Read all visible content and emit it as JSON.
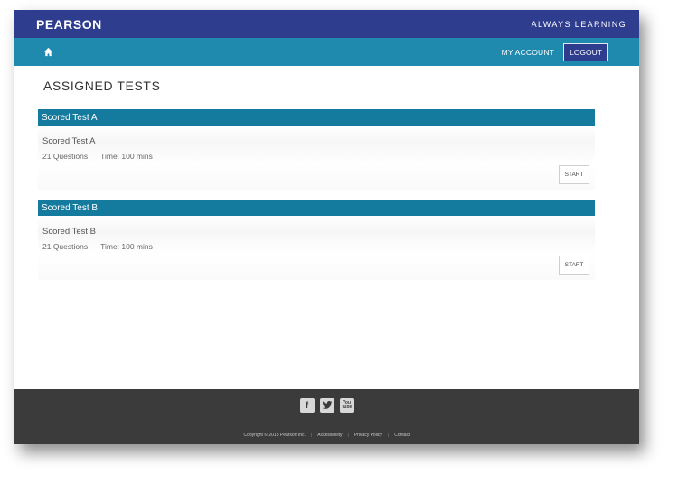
{
  "header": {
    "brand": "PEARSON",
    "tagline": "ALWAYS LEARNING"
  },
  "nav": {
    "home_icon": "home-icon",
    "my_account": "MY ACCOUNT",
    "logout": "LOGOUT"
  },
  "main": {
    "title": "ASSIGNED TESTS",
    "tests": [
      {
        "header": "Scored Test A",
        "name": "Scored Test A",
        "questions": "21 Questions",
        "time": "Time: 100 mins",
        "button": "START"
      },
      {
        "header": "Scored Test B",
        "name": "Scored Test B",
        "questions": "21 Questions",
        "time": "Time: 100 mins",
        "button": "START"
      }
    ]
  },
  "footer": {
    "social": {
      "facebook": "f",
      "twitter": "t",
      "youtube": "You Tube"
    },
    "copyright": "Copyright © 2015 Pearson Inc.",
    "links": [
      "Accessibility",
      "Privacy Policy",
      "Contact"
    ]
  },
  "colors": {
    "topbar": "#2f3d8f",
    "navbar": "#1f8aae",
    "card_header": "#147a9e",
    "footer": "#3b3b3b"
  }
}
